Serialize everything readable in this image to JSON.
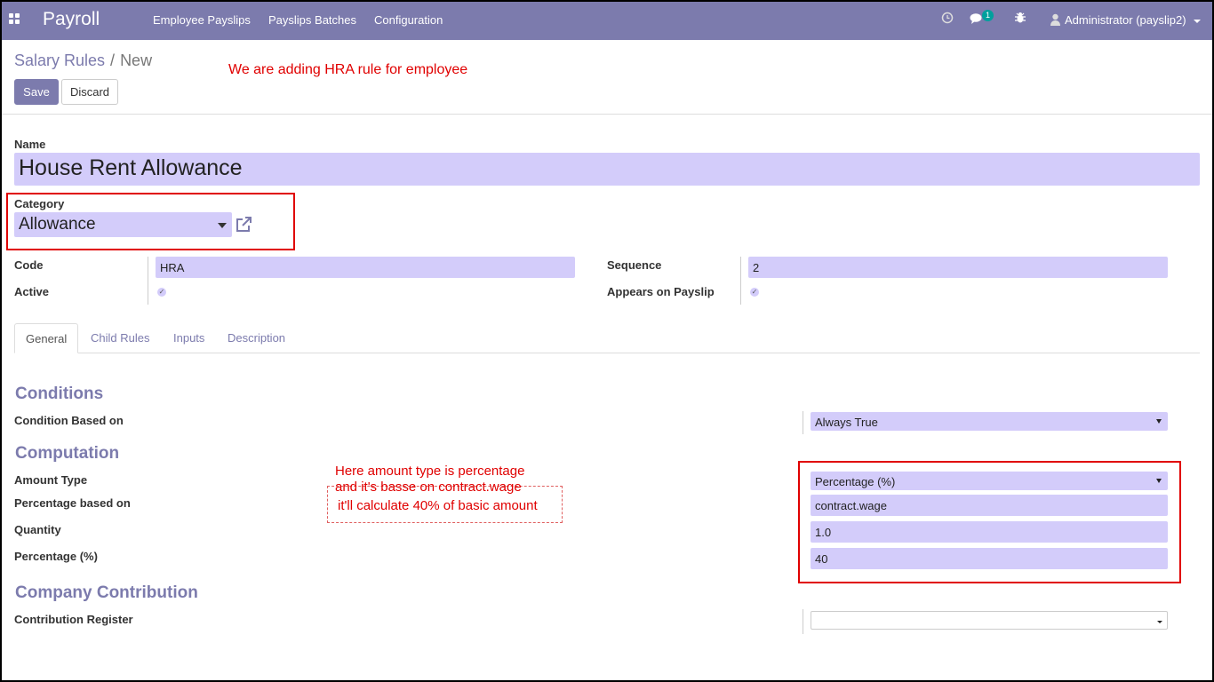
{
  "navbar": {
    "app_name": "Payroll",
    "menu": [
      "Employee Payslips",
      "Payslips Batches",
      "Configuration"
    ],
    "message_count": "1",
    "user": "Administrator (payslip2)",
    "color": "#7c7bad"
  },
  "breadcrumb": {
    "parent": "Salary Rules",
    "separator": "/",
    "current": "New"
  },
  "buttons": {
    "save": "Save",
    "discard": "Discard"
  },
  "annotations": {
    "top_note": "We are adding HRA rule for employee",
    "middle_note": [
      "Here amount type is percentage",
      "and it's basse on contract.wage",
      "it'll calculate 40% of basic amount"
    ],
    "color": "#e00000"
  },
  "form": {
    "name_label": "Name",
    "name_value": "House Rent Allowance",
    "category_label": "Category",
    "category_value": "Allowance",
    "code_label": "Code",
    "code_value": "HRA",
    "active_label": "Active",
    "sequence_label": "Sequence",
    "sequence_value": "2",
    "appears_label": "Appears on Payslip"
  },
  "tabs": [
    "General",
    "Child Rules",
    "Inputs",
    "Description"
  ],
  "conditions": {
    "title": "Conditions",
    "condition_label": "Condition Based on",
    "condition_value": "Always True"
  },
  "computation": {
    "title": "Computation",
    "amount_type_label": "Amount Type",
    "amount_type_value": "Percentage (%)",
    "percentage_based_label": "Percentage based on",
    "percentage_based_value": "contract.wage",
    "quantity_label": "Quantity",
    "quantity_value": "1.0",
    "percentage_label": "Percentage (%)",
    "percentage_value": "40"
  },
  "company_contribution": {
    "title": "Company Contribution",
    "register_label": "Contribution Register",
    "register_value": ""
  }
}
